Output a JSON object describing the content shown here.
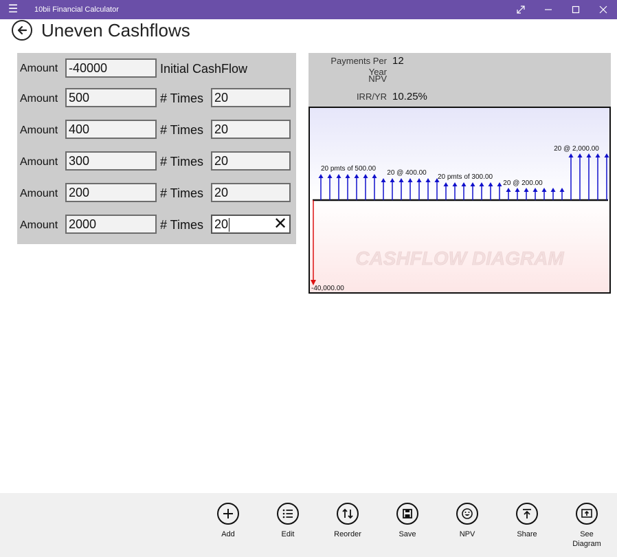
{
  "window": {
    "title": "10bii Financial Calculator",
    "accent": "#6a4fa8"
  },
  "header": {
    "title": "Uneven Cashflows"
  },
  "cashflows": {
    "initial": {
      "label": "Amount",
      "value": "-40000",
      "note": "Initial CashFlow"
    },
    "rows": [
      {
        "label": "Amount",
        "amount": "500",
        "times_label": "# Times",
        "times": "20"
      },
      {
        "label": "Amount",
        "amount": "400",
        "times_label": "# Times",
        "times": "20"
      },
      {
        "label": "Amount",
        "amount": "300",
        "times_label": "# Times",
        "times": "20"
      },
      {
        "label": "Amount",
        "amount": "200",
        "times_label": "# Times",
        "times": "20"
      },
      {
        "label": "Amount",
        "amount": "2000",
        "times_label": "# Times",
        "times": "20"
      }
    ]
  },
  "stats": {
    "payments_per_year_label": "Payments Per Year",
    "payments_per_year": "12",
    "npv_label": "NPV",
    "npv": "",
    "irr_label": "IRR/YR",
    "irr": "10.25%"
  },
  "diagram": {
    "watermark": "CASHFLOW DIAGRAM",
    "initial_label": "-40,000.00",
    "group_labels": [
      "20 pmts of 500.00",
      "20 @ 400.00",
      "20 pmts of 300.00",
      "20 @ 200.00",
      "20 @ 2,000.00"
    ],
    "colors": {
      "positive": "#1010cc",
      "negative": "#dd1111"
    }
  },
  "toolbar": {
    "buttons": [
      {
        "label": "Add",
        "icon": "plus-icon"
      },
      {
        "label": "Edit",
        "icon": "list-icon"
      },
      {
        "label": "Reorder",
        "icon": "reorder-icon"
      },
      {
        "label": "Save",
        "icon": "save-icon"
      },
      {
        "label": "NPV",
        "icon": "smiley-icon"
      },
      {
        "label": "Share",
        "icon": "share-icon"
      },
      {
        "label": "See Diagram",
        "icon": "diagram-icon"
      }
    ]
  }
}
